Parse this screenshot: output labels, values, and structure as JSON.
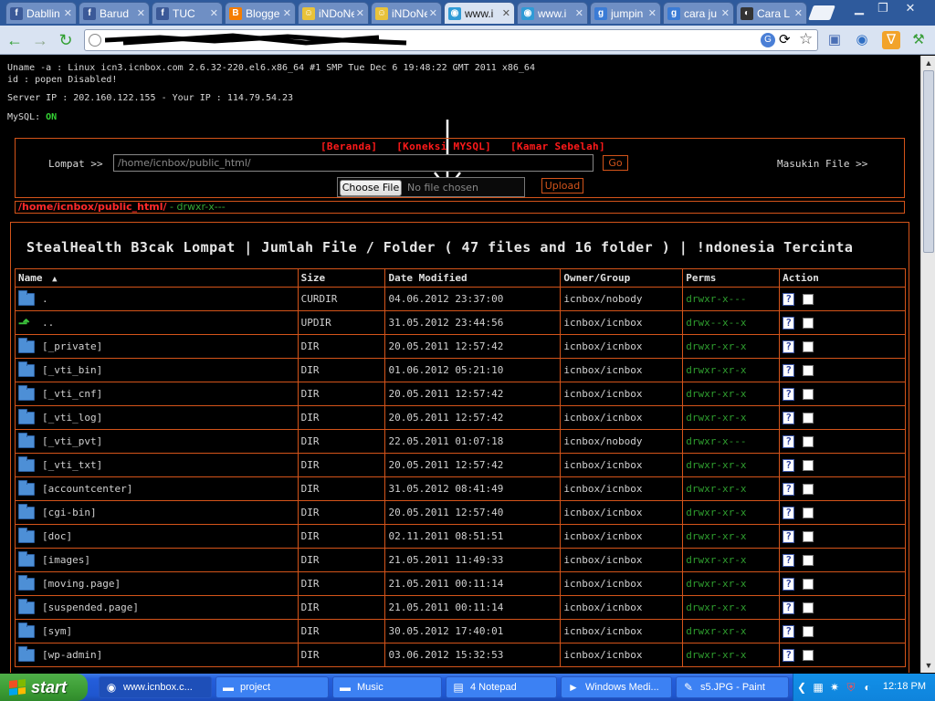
{
  "browser": {
    "tabs": [
      {
        "title": "Dabllin",
        "favicon": "facebook-icon",
        "color": "#3b5998",
        "letter": "f"
      },
      {
        "title": "Barud",
        "favicon": "facebook-icon",
        "color": "#3b5998",
        "letter": "f"
      },
      {
        "title": "TUC",
        "favicon": "facebook-icon",
        "color": "#3b5998",
        "letter": "f"
      },
      {
        "title": "Blogge",
        "favicon": "blogger-icon",
        "color": "#f57d00",
        "letter": "B"
      },
      {
        "title": "iNDoNe",
        "favicon": "emoji-face-icon",
        "color": "#e8c23a",
        "letter": "☺"
      },
      {
        "title": "iNDoNe",
        "favicon": "emoji-face-icon",
        "color": "#e8c23a",
        "letter": "☺"
      },
      {
        "title": "www.i",
        "favicon": "globe-icon",
        "color": "#2f9bd6",
        "letter": "◉"
      },
      {
        "title": "www.i",
        "favicon": "globe-icon",
        "color": "#2f9bd6",
        "letter": "◉"
      },
      {
        "title": "jumpin",
        "favicon": "google-icon",
        "color": "#3a7bd5",
        "letter": "g"
      },
      {
        "title": "cara ju",
        "favicon": "google-icon",
        "color": "#3a7bd5",
        "letter": "g"
      },
      {
        "title": "Cara L",
        "favicon": "site-icon",
        "color": "#333333",
        "letter": "◐"
      }
    ],
    "active_tab": 6
  },
  "page": {
    "sys_uname": "Uname -a : Linux icn3.icnbox.com 2.6.32-220.el6.x86_64 #1 SMP Tue Dec 6 19:48:22 GMT 2011 x86_64",
    "sys_id": "id : popen Disabled!",
    "sys_ip": "Server IP : 202.160.122.155 - Your IP : 114.79.54.23",
    "mysql_label": "MySQL:",
    "mysql_status": "ON",
    "nav_links": [
      "[Beranda]",
      "[Koneksi MYSQL]",
      "[Kamar Sebelah]"
    ],
    "jump_label": "Lompat >>",
    "path_value": "/home/icnbox/public_html/",
    "go_label": "Go",
    "upload_label": "Masukin File >>",
    "choose_file_label": "Choose File",
    "no_file_label": "No file chosen",
    "upload_btn_label": "Upload",
    "current_path": "/home/icnbox/public_html/",
    "current_perm_sep": " - ",
    "current_perm": "drwxr-x---",
    "heading": "StealHealth B3cak Lompat | Jumlah File / Folder ( 47 files and 16 folder ) | !ndonesia Tercinta",
    "columns": [
      "Name",
      "Size",
      "Date Modified",
      "Owner/Group",
      "Perms",
      "Action"
    ],
    "sort_indicator": "▲",
    "files": [
      {
        "name": ".",
        "size": "CURDIR",
        "date": "04.06.2012 23:37:00",
        "owner": "icnbox/nobody",
        "perms": "drwxr-x---",
        "icon": "folder"
      },
      {
        "name": "..",
        "size": "UPDIR",
        "date": "31.05.2012 23:44:56",
        "owner": "icnbox/icnbox",
        "perms": "drwx--x--x",
        "icon": "up"
      },
      {
        "name": "[_private]",
        "size": "DIR",
        "date": "20.05.2011 12:57:42",
        "owner": "icnbox/icnbox",
        "perms": "drwxr-xr-x",
        "icon": "folder"
      },
      {
        "name": "[_vti_bin]",
        "size": "DIR",
        "date": "01.06.2012 05:21:10",
        "owner": "icnbox/icnbox",
        "perms": "drwxr-xr-x",
        "icon": "folder"
      },
      {
        "name": "[_vti_cnf]",
        "size": "DIR",
        "date": "20.05.2011 12:57:42",
        "owner": "icnbox/icnbox",
        "perms": "drwxr-xr-x",
        "icon": "folder"
      },
      {
        "name": "[_vti_log]",
        "size": "DIR",
        "date": "20.05.2011 12:57:42",
        "owner": "icnbox/icnbox",
        "perms": "drwxr-xr-x",
        "icon": "folder"
      },
      {
        "name": "[_vti_pvt]",
        "size": "DIR",
        "date": "22.05.2011 01:07:18",
        "owner": "icnbox/nobody",
        "perms": "drwxr-x---",
        "icon": "folder"
      },
      {
        "name": "[_vti_txt]",
        "size": "DIR",
        "date": "20.05.2011 12:57:42",
        "owner": "icnbox/icnbox",
        "perms": "drwxr-xr-x",
        "icon": "folder"
      },
      {
        "name": "[accountcenter]",
        "size": "DIR",
        "date": "31.05.2012 08:41:49",
        "owner": "icnbox/icnbox",
        "perms": "drwxr-xr-x",
        "icon": "folder"
      },
      {
        "name": "[cgi-bin]",
        "size": "DIR",
        "date": "20.05.2011 12:57:40",
        "owner": "icnbox/icnbox",
        "perms": "drwxr-xr-x",
        "icon": "folder"
      },
      {
        "name": "[doc]",
        "size": "DIR",
        "date": "02.11.2011 08:51:51",
        "owner": "icnbox/icnbox",
        "perms": "drwxr-xr-x",
        "icon": "folder"
      },
      {
        "name": "[images]",
        "size": "DIR",
        "date": "21.05.2011 11:49:33",
        "owner": "icnbox/icnbox",
        "perms": "drwxr-xr-x",
        "icon": "folder"
      },
      {
        "name": "[moving.page]",
        "size": "DIR",
        "date": "21.05.2011 00:11:14",
        "owner": "icnbox/icnbox",
        "perms": "drwxr-xr-x",
        "icon": "folder"
      },
      {
        "name": "[suspended.page]",
        "size": "DIR",
        "date": "21.05.2011 00:11:14",
        "owner": "icnbox/icnbox",
        "perms": "drwxr-xr-x",
        "icon": "folder"
      },
      {
        "name": "[sym]",
        "size": "DIR",
        "date": "30.05.2012 17:40:01",
        "owner": "icnbox/icnbox",
        "perms": "drwxr-xr-x",
        "icon": "folder"
      },
      {
        "name": "[wp-admin]",
        "size": "DIR",
        "date": "03.06.2012 15:32:53",
        "owner": "icnbox/icnbox",
        "perms": "drwxr-xr-x",
        "icon": "folder"
      }
    ]
  },
  "taskbar": {
    "start_label": "start",
    "tasks": [
      {
        "label": "www.icnbox.c...",
        "icon": "chrome-icon",
        "active": true
      },
      {
        "label": "project",
        "icon": "folder-icon",
        "active": false
      },
      {
        "label": "Music",
        "icon": "folder-icon",
        "active": false
      },
      {
        "label": "4 Notepad",
        "icon": "notepad-icon",
        "active": false
      },
      {
        "label": "Windows Medi...",
        "icon": "media-player-icon",
        "active": false
      },
      {
        "label": "s5.JPG - Paint",
        "icon": "paint-icon",
        "active": false
      }
    ],
    "clock": "12:18 PM"
  },
  "colors": {
    "accent_border": "#d4541a",
    "link_red": "#ff1a1a",
    "ok_green": "#35d635"
  }
}
